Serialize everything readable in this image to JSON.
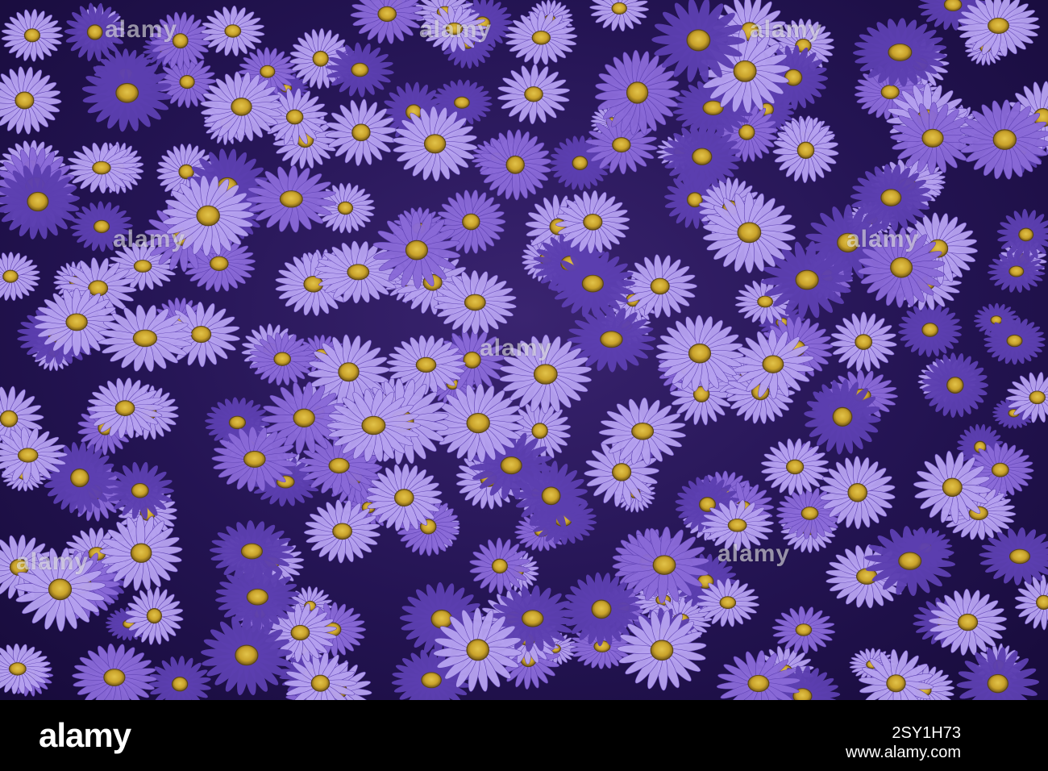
{
  "photo": {
    "subject": "field of purple daisy flowers with yellow centers",
    "colors": {
      "background": "#1c0f45",
      "petal_light": "#b6a2f0",
      "petal_mid": "#8a6ad8",
      "petal_dark": "#5c3fb0",
      "center": "#c9a22a",
      "center_dark": "#5a4417"
    }
  },
  "watermark": {
    "text": "alamy"
  },
  "footer": {
    "logo_text": "alamy",
    "image_id": "2SY1H73",
    "url": "www.alamy.com"
  }
}
